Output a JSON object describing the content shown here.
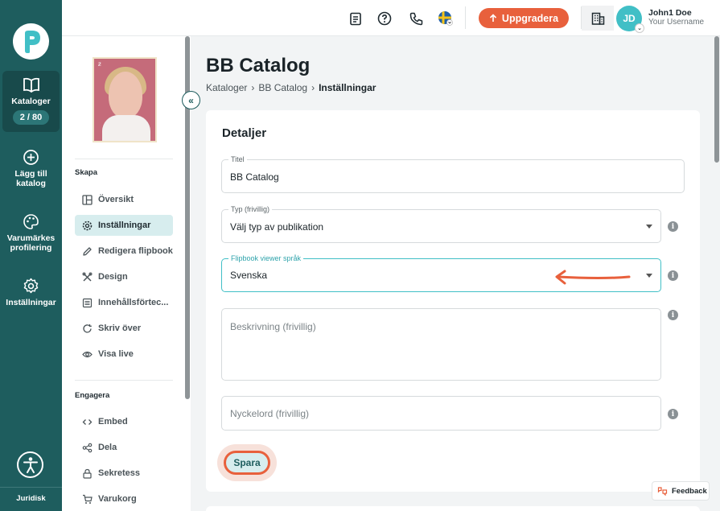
{
  "rail": {
    "items": [
      {
        "label": "Kataloger",
        "badge": "2 / 80",
        "icon": "book-open-icon"
      },
      {
        "label": "Lägg till katalog",
        "icon": "plus-circle-icon"
      },
      {
        "label": "Varumärkes profilering",
        "icon": "palette-icon"
      },
      {
        "label": "Inställningar",
        "icon": "gear-icon"
      }
    ],
    "legal": "Juridisk"
  },
  "topbar": {
    "upgrade_label": "Uppgradera",
    "user_name": "John1 Doe",
    "user_sub": "Your Username",
    "avatar_initials": "JD"
  },
  "sidebar": {
    "section1": "Skapa",
    "items1": [
      {
        "label": "Översikt"
      },
      {
        "label": "Inställningar"
      },
      {
        "label": "Redigera flipbook"
      },
      {
        "label": "Design"
      },
      {
        "label": "Innehållsförtec..."
      },
      {
        "label": "Skriv över"
      },
      {
        "label": "Visa live"
      }
    ],
    "section2": "Engagera",
    "items2": [
      {
        "label": "Embed"
      },
      {
        "label": "Dela"
      },
      {
        "label": "Sekretess"
      },
      {
        "label": "Varukorg"
      }
    ]
  },
  "main": {
    "title": "BB Catalog",
    "breadcrumb": [
      "Kataloger",
      "BB Catalog",
      "Inställningar"
    ],
    "card_title": "Detaljer",
    "fields": {
      "title_label": "Titel",
      "title_value": "BB Catalog",
      "type_label": "Typ (frivillig)",
      "type_value": "Välj typ av publikation",
      "lang_label": "Flipbook viewer språk",
      "lang_value": "Svenska",
      "desc_placeholder": "Beskrivning (frivillig)",
      "keywords_placeholder": "Nyckelord (frivillig)"
    },
    "save_label": "Spara",
    "feedback_label": "Feedback"
  },
  "colors": {
    "rail": "#1e5d5e",
    "accent": "#e8603c",
    "teal": "#41bfc6"
  }
}
